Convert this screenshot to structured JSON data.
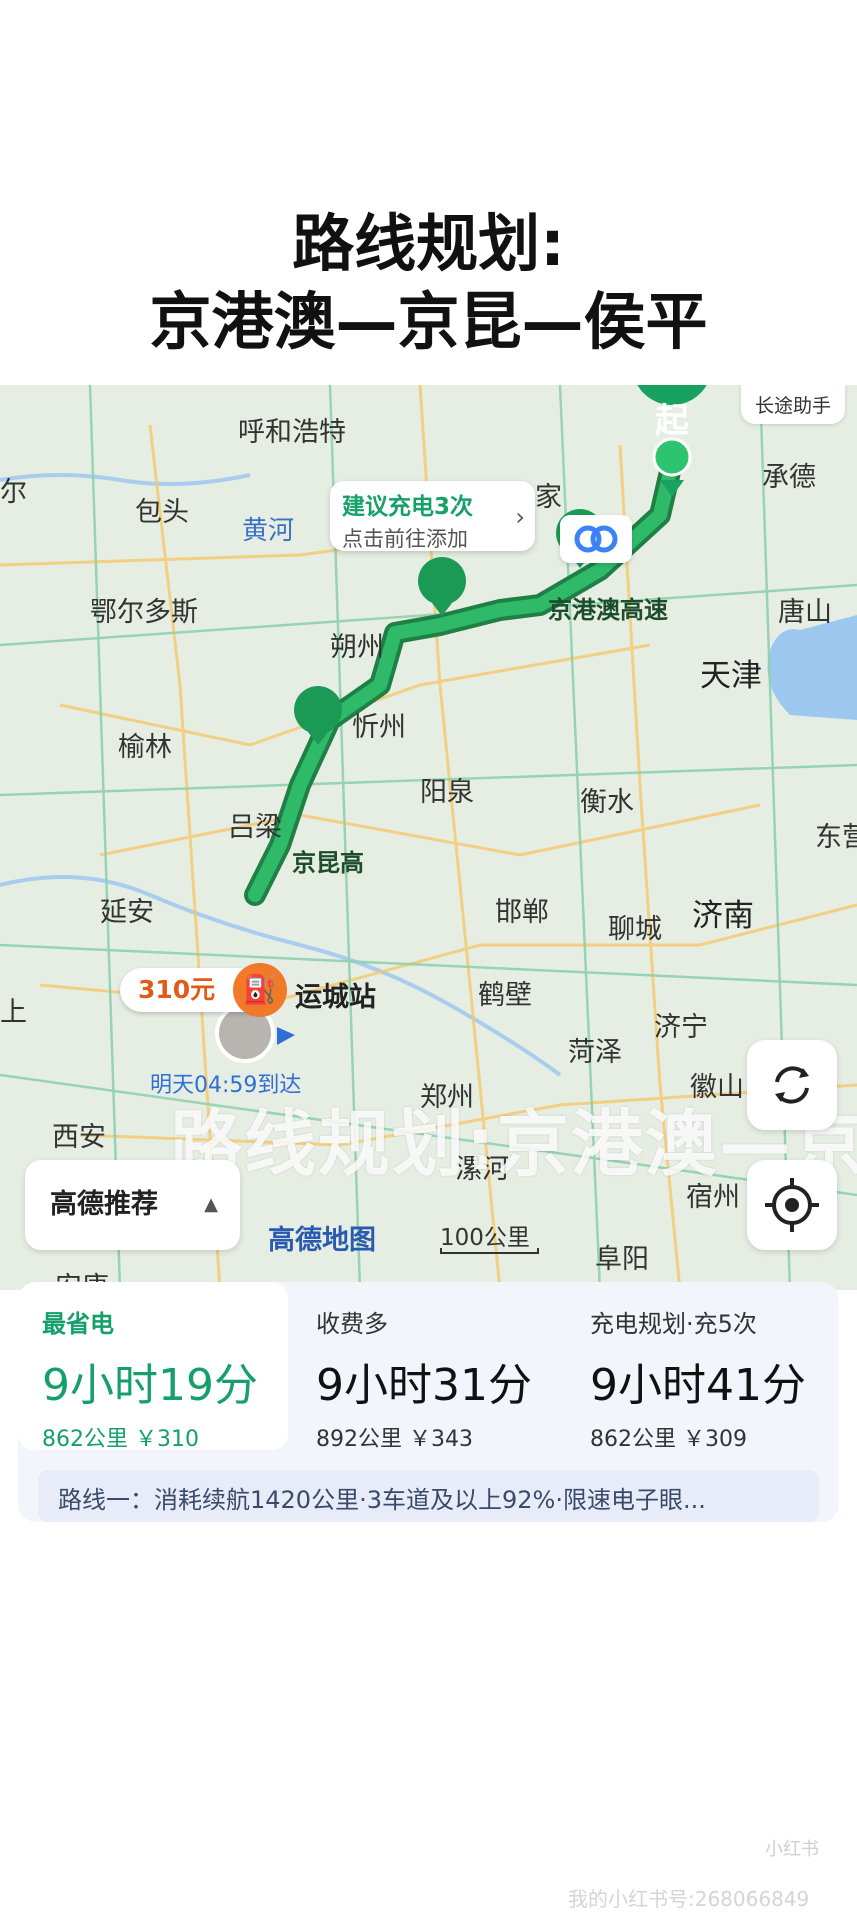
{
  "title": {
    "line1": "路线规划:",
    "line2": "京港澳—京昆—侯平"
  },
  "map": {
    "assist_chip": "长途助手",
    "cities": [
      "呼和浩特",
      "包头",
      "鄂尔多斯",
      "朔州",
      "忻州",
      "阳泉",
      "榆林",
      "吕梁",
      "延安",
      "邯郸",
      "聊城",
      "济南",
      "衡水",
      "天津",
      "唐山",
      "承德",
      "东营",
      "鹤壁",
      "菏泽",
      "济宁",
      "郑州",
      "漯河",
      "宿州",
      "阜阳",
      "西安",
      "徽山",
      "尔",
      "家",
      "上",
      "安康"
    ],
    "river": "黄河",
    "start_marker": "起",
    "highway_labels": [
      "京港澳高速",
      "京昆高"
    ],
    "charge_tip": {
      "title": "建议充电3次",
      "subtitle": "点击前往添加"
    },
    "price_tag": "310元",
    "station": "运城站",
    "eta": "明天04:59到达",
    "watermark": "路线规划:京港澳—京昆",
    "recommend_dropdown": "高德推荐",
    "logo": "高德地图",
    "scale": "100公里",
    "route_color": "#20a65e",
    "accent": "#15a06a"
  },
  "routes": [
    {
      "name": "最省电",
      "time": "9小时19分",
      "meta": "862公里 ￥310"
    },
    {
      "name": "收费多",
      "time": "9小时31分",
      "meta": "892公里 ￥343"
    },
    {
      "name": "充电规划·充5次",
      "time": "9小时41分",
      "meta": "862公里 ￥309"
    }
  ],
  "route_detail": "路线一：消耗续航1420公里·3车道及以上92%·限速电子眼...",
  "footer": {
    "badge": "小红书",
    "id": "我的小红书号:268066849"
  }
}
